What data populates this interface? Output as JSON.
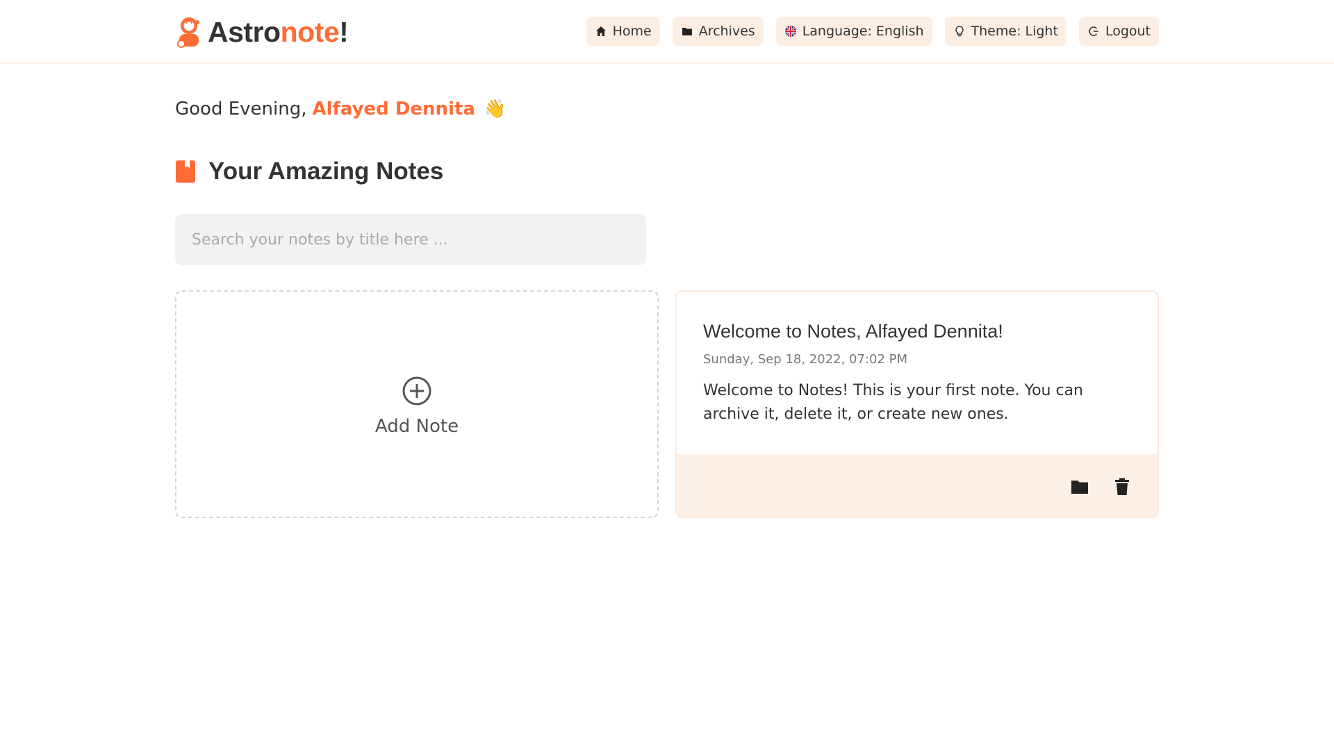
{
  "brand": {
    "name_main": "Astro",
    "name_accent": "note",
    "name_suffix": "!",
    "accent_color": "#ff6b35",
    "icon": "astronaut-icon"
  },
  "nav": {
    "home": {
      "label": "Home",
      "icon": "home-icon"
    },
    "archives": {
      "label": "Archives",
      "icon": "folder-icon"
    },
    "language": {
      "label": "Language: English",
      "icon": "uk-flag-icon"
    },
    "theme": {
      "label": "Theme: Light",
      "icon": "lightbulb-icon"
    },
    "logout": {
      "label": "Logout",
      "icon": "logout-icon"
    }
  },
  "greeting": {
    "prefix": "Good Evening,",
    "name": "Alfayed Dennita",
    "emoji": "👋"
  },
  "section": {
    "title": "Your Amazing Notes",
    "icon": "book-icon"
  },
  "search": {
    "value": "",
    "placeholder": "Search your notes by title here ..."
  },
  "add_note": {
    "label": "Add Note",
    "icon": "plus-circle-icon"
  },
  "notes": [
    {
      "title": "Welcome to Notes, Alfayed Dennita!",
      "date": "Sunday, Sep 18, 2022, 07:02 PM",
      "body": "Welcome to Notes! This is your first note. You can archive it, delete it, or create new ones.",
      "actions": [
        "folder-icon",
        "trash-icon"
      ]
    }
  ],
  "colors": {
    "accent": "#ff6b35",
    "nav_bg": "#fdeee3",
    "card_footer_bg": "#fdf0e6",
    "search_bg": "#f2f2f2"
  }
}
